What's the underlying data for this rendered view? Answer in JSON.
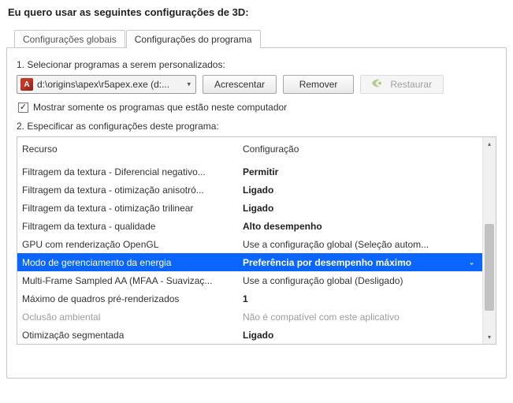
{
  "title": "Eu quero usar as seguintes configurações de 3D:",
  "tabs": {
    "global": "Configurações globais",
    "program": "Configurações do programa"
  },
  "step1": {
    "label": "1. Selecionar programas a serem personalizados:",
    "selected_program": "d:\\origins\\apex\\r5apex.exe (d:...",
    "add_btn": "Acrescentar",
    "remove_btn": "Remover",
    "restore_btn": "Restaurar"
  },
  "checkbox": {
    "label": "Mostrar somente os programas que estão neste computador"
  },
  "step2": {
    "label": "2. Especificar as configurações deste programa:"
  },
  "headers": {
    "feature": "Recurso",
    "setting": "Configuração"
  },
  "rows": [
    {
      "feature": "Filtragem da textura - Diferencial negativo...",
      "setting": "Permitir",
      "bold": true
    },
    {
      "feature": "Filtragem da textura - otimização anisotró...",
      "setting": "Ligado",
      "bold": true
    },
    {
      "feature": "Filtragem da textura - otimização trilinear",
      "setting": "Ligado",
      "bold": true
    },
    {
      "feature": "Filtragem da textura - qualidade",
      "setting": "Alto desempenho",
      "bold": true
    },
    {
      "feature": "GPU com renderização OpenGL",
      "setting": "Use a configuração global (Seleção autom..."
    },
    {
      "feature": "Modo de gerenciamento da energia",
      "setting": "Preferência por desempenho máximo",
      "selected": true
    },
    {
      "feature": "Multi-Frame Sampled AA (MFAA - Suavizaç...",
      "setting": "Use a configuração global (Desligado)"
    },
    {
      "feature": "Máximo de quadros pré-renderizados",
      "setting": "1",
      "bold": true
    },
    {
      "feature": "Oclusão ambiental",
      "setting": "Não é compatível com este aplicativo",
      "disabled": true
    },
    {
      "feature": "Otimização segmentada",
      "setting": "Ligado",
      "bold": true
    }
  ]
}
